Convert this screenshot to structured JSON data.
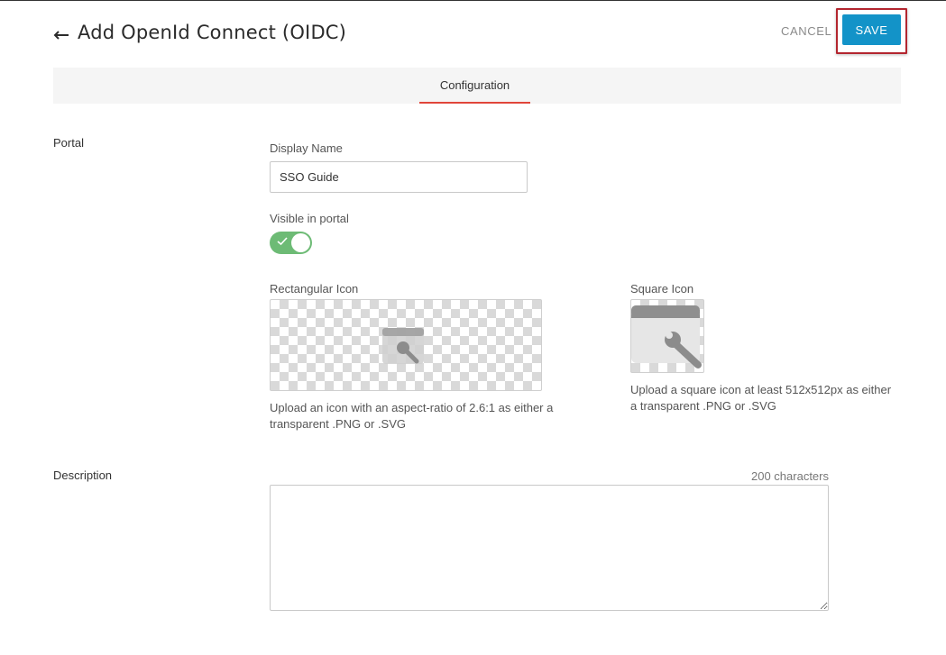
{
  "header": {
    "title": "Add OpenId Connect (OIDC)",
    "cancel_label": "CANCEL",
    "save_label": "SAVE"
  },
  "tabs": [
    {
      "label": "Configuration",
      "active": true
    }
  ],
  "portal": {
    "section_label": "Portal",
    "display_name_label": "Display Name",
    "display_name_value": "SSO Guide",
    "visible_label": "Visible in portal",
    "visible_on": true,
    "rect_icon_label": "Rectangular Icon",
    "rect_icon_help": "Upload an icon with an aspect-ratio of 2.6:1 as either a transparent .PNG or .SVG",
    "square_icon_label": "Square Icon",
    "square_icon_help": "Upload a square icon at least 512x512px as either a transparent .PNG or .SVG"
  },
  "description": {
    "section_label": "Description",
    "char_limit": "200 characters",
    "value": ""
  },
  "colors": {
    "accent": "#1393c8",
    "tab_underline": "#e0453a",
    "toggle_on": "#6dbb75",
    "highlight_border": "#b3262f"
  },
  "icons": {
    "back": "arrow-left-icon",
    "placeholder": "wrench-app-icon"
  }
}
